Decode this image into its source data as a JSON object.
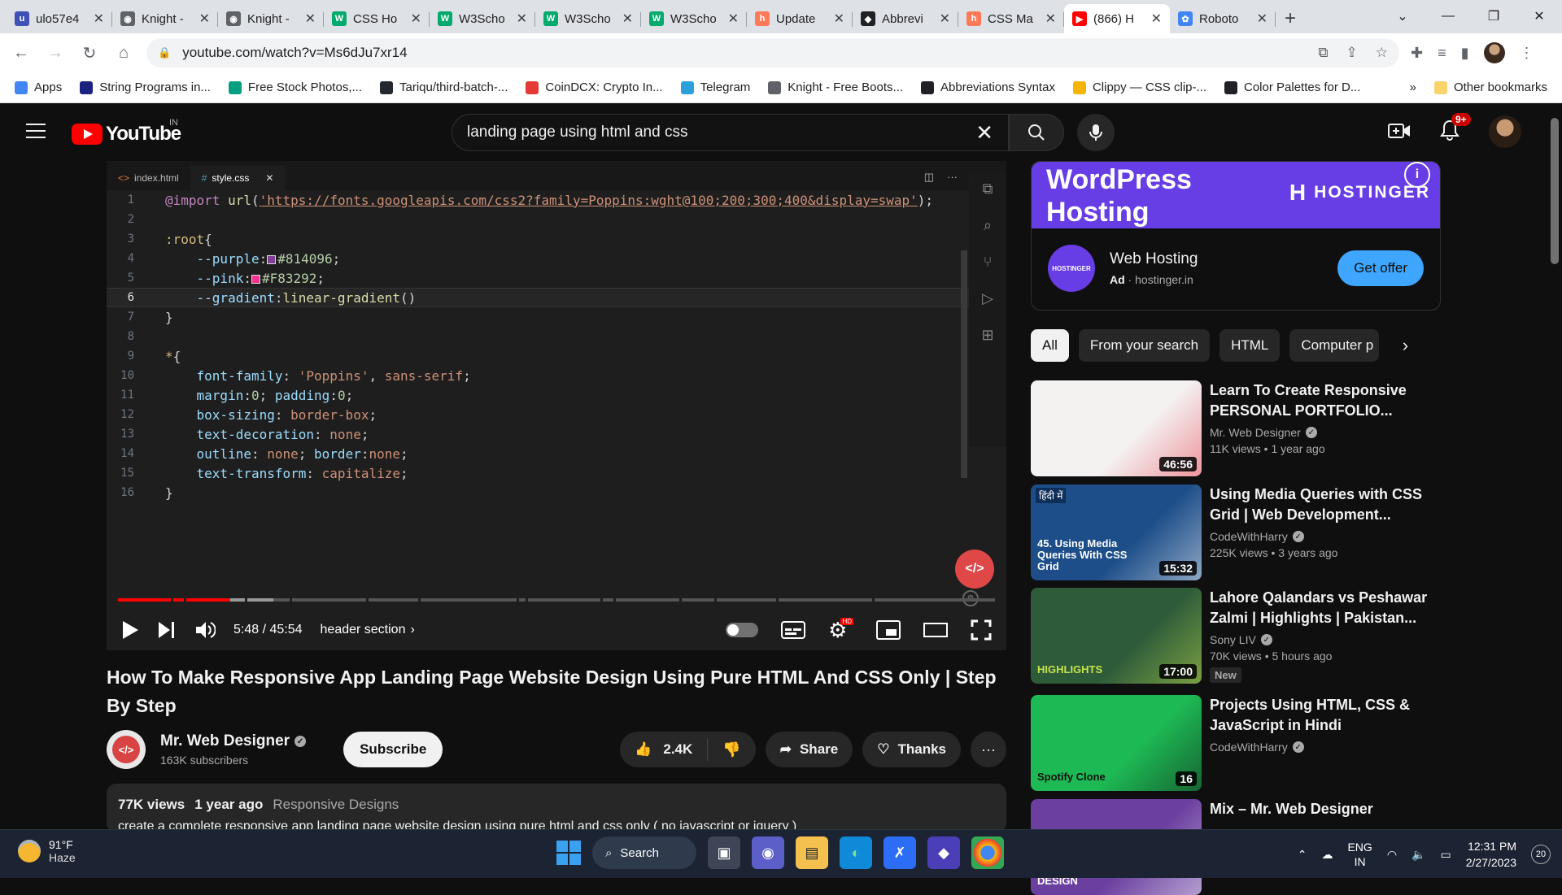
{
  "browser": {
    "tabs": [
      {
        "title": "ulo57e4",
        "fav_color": "#3f51b5",
        "fav_glyph": "u"
      },
      {
        "title": "Knight -",
        "fav_color": "#5f6368",
        "fav_glyph": "◉"
      },
      {
        "title": "Knight -",
        "fav_color": "#5f6368",
        "fav_glyph": "◉"
      },
      {
        "title": "CSS Ho",
        "fav_color": "#04aa6d",
        "fav_glyph": "W"
      },
      {
        "title": "W3Scho",
        "fav_color": "#04aa6d",
        "fav_glyph": "W"
      },
      {
        "title": "W3Scho",
        "fav_color": "#04aa6d",
        "fav_glyph": "W"
      },
      {
        "title": "W3Scho",
        "fav_color": "#04aa6d",
        "fav_glyph": "W"
      },
      {
        "title": "Update",
        "fav_color": "#ff7a59",
        "fav_glyph": "h"
      },
      {
        "title": "Abbrevi",
        "fav_color": "#202124",
        "fav_glyph": "◆"
      },
      {
        "title": "CSS Ma",
        "fav_color": "#ff7a59",
        "fav_glyph": "h"
      },
      {
        "title": "(866) H",
        "fav_color": "#ff0000",
        "fav_glyph": "▶"
      },
      {
        "title": "Roboto",
        "fav_color": "#4285f4",
        "fav_glyph": "✿"
      }
    ],
    "active_tab_index": 10,
    "url": "youtube.com/watch?v=Ms6dJu7xr14",
    "bookmarks": [
      {
        "label": "Apps",
        "color": "#4285f4"
      },
      {
        "label": "String Programs in...",
        "color": "#1a237e"
      },
      {
        "label": "Free Stock Photos,...",
        "color": "#05a081"
      },
      {
        "label": "Tariqu/third-batch-...",
        "color": "#24292f"
      },
      {
        "label": "CoinDCX: Crypto In...",
        "color": "#e53935"
      },
      {
        "label": "Telegram",
        "color": "#2aa1da"
      },
      {
        "label": "Knight - Free Boots...",
        "color": "#5f6368"
      },
      {
        "label": "Abbreviations Syntax",
        "color": "#202124"
      },
      {
        "label": "Clippy — CSS clip-...",
        "color": "#f4b400"
      },
      {
        "label": "Color Palettes for D...",
        "color": "#202124"
      }
    ],
    "bookmarks_more": "»",
    "other_bookmarks": "Other bookmarks"
  },
  "youtube": {
    "logo_text": "YouTube",
    "country_code": "IN",
    "search_query": "landing page using html and css",
    "notif_count": "9+"
  },
  "player": {
    "editor_tabs": [
      {
        "label": "index.html",
        "icon": "<>"
      },
      {
        "label": "style.css",
        "icon": "#"
      }
    ],
    "code_lines": [
      {
        "n": "1",
        "html": "<span class='k'>@import</span> <span class='f'>url</span>(<span class='u'>'https://fonts.googleapis.com/css2?family=Poppins:wght@100;200;300;400&amp;display=swap'</span>);"
      },
      {
        "n": "2",
        "html": ""
      },
      {
        "n": "3",
        "html": "<span class='sel'>:root</span>{"
      },
      {
        "n": "4",
        "html": "    <span class='p'>--purple</span>:<span class='sw' style='background:#814096'></span><span class='v'>#814096</span>;"
      },
      {
        "n": "5",
        "html": "    <span class='p'>--pink</span>:<span class='sw' style='background:#F83292'></span><span class='v'>#F83292</span>;"
      },
      {
        "n": "6",
        "html": "    <span class='p'>--gradient</span>:<span class='f'>linear-gradient</span>()"
      },
      {
        "n": "7",
        "html": "}"
      },
      {
        "n": "8",
        "html": ""
      },
      {
        "n": "9",
        "html": "<span class='sel'>*</span>{"
      },
      {
        "n": "10",
        "html": "    <span class='p'>font-family</span>: <span class='s'>'Poppins'</span>, <span class='s'>sans-serif</span>;"
      },
      {
        "n": "11",
        "html": "    <span class='p'>margin</span>:<span class='v'>0</span>; <span class='p'>padding</span>:<span class='v'>0</span>;"
      },
      {
        "n": "12",
        "html": "    <span class='p'>box-sizing</span>: <span class='s'>border-box</span>;"
      },
      {
        "n": "13",
        "html": "    <span class='p'>text-decoration</span>: <span class='s'>none</span>;"
      },
      {
        "n": "14",
        "html": "    <span class='p'>outline</span>: <span class='s'>none</span>; <span class='p'>border</span>:<span class='s'>none</span>;"
      },
      {
        "n": "15",
        "html": "    <span class='p'>text-transform</span>: <span class='s'>capitalize</span>;"
      },
      {
        "n": "16",
        "html": "}"
      }
    ],
    "current_line": "6",
    "progress_fraction": 0.127,
    "time_current": "5:48",
    "time_total": "45:54",
    "time_display": "5:48 / 45:54",
    "chapter": "header section",
    "channel_badge": "</>"
  },
  "video": {
    "title": "How To Make Responsive App Landing Page Website Design Using Pure HTML And CSS Only | Step By Step",
    "channel_name": "Mr. Web Designer",
    "subscribers": "163K subscribers",
    "subscribe_label": "Subscribe",
    "likes": "2.4K",
    "share_label": "Share",
    "thanks_label": "Thanks",
    "views": "77K views",
    "age": "1 year ago",
    "hashtag": "Responsive Designs",
    "description": "create a complete responsive app landing page website design using pure html and css only ( no javascript or jquery )"
  },
  "ad": {
    "banner_title": "WordPress Hosting",
    "brand": "HOSTINGER",
    "logo_text": "HOSTINGER",
    "title": "Web Hosting",
    "ad_label": "Ad",
    "domain": "hostinger.in",
    "cta": "Get offer"
  },
  "chips": [
    "All",
    "From your search",
    "HTML",
    "Computer p"
  ],
  "recommendations": [
    {
      "title": "Learn To Create Responsive PERSONAL PORTFOLIO...",
      "channel": "Mr. Web Designer",
      "verified": true,
      "stats": "11K views • 1 year ago",
      "duration": "46:56",
      "thumb": "#f4f1f1",
      "accent": "#e63946",
      "new": ""
    },
    {
      "title": "Using Media Queries with CSS Grid | Web Development...",
      "channel": "CodeWithHarry",
      "verified": true,
      "stats": "225K views • 3 years ago",
      "duration": "15:32",
      "thumb": "#1d4e89",
      "accent": "#ffffff",
      "thumb_text": "45. Using Media Queries With CSS Grid",
      "thumb_tag": "हिंदी में",
      "new": ""
    },
    {
      "title": "Lahore Qalandars vs Peshawar Zalmi | Highlights | Pakistan...",
      "channel": "Sony LIV",
      "verified": true,
      "stats": "70K views • 5 hours ago",
      "duration": "17:00",
      "thumb": "#2e5b3a",
      "accent": "#c6e34a",
      "thumb_text": "HIGHLIGHTS",
      "new": "New"
    },
    {
      "title": "Projects Using HTML, CSS & JavaScript in Hindi",
      "channel": "CodeWithHarry",
      "verified": true,
      "stats": "",
      "duration": "16",
      "thumb": "#1db954",
      "accent": "#111111",
      "thumb_text": "Spotify Clone",
      "new": ""
    },
    {
      "title": "Mix – Mr. Web Designer",
      "channel": "",
      "verified": false,
      "stats": "",
      "duration": "",
      "thumb": "#6b3fa0",
      "accent": "#ffffff",
      "thumb_text": "PURE HTML AND CSS WEBSITE DESIGN",
      "new": ""
    }
  ],
  "taskbar": {
    "temp": "91°F",
    "weather": "Haze",
    "search_label": "Search",
    "lang_1": "ENG",
    "lang_2": "IN",
    "time": "12:31 PM",
    "date": "2/27/2023",
    "notif_count": "20"
  }
}
